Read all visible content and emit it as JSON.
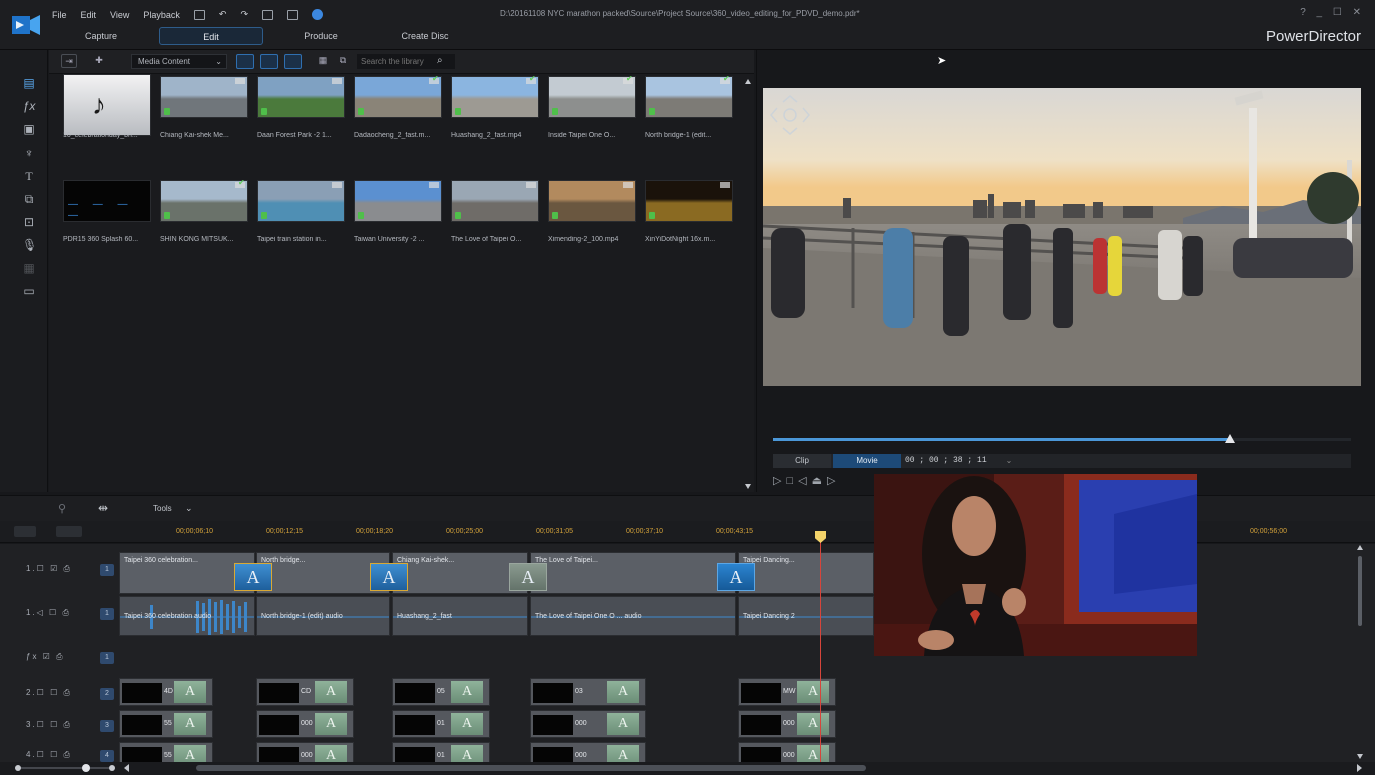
{
  "app": {
    "brand": "PowerDirector",
    "file_path": "D:\\20161108 NYC marathon packed\\Source\\Project Source\\360_video_editing_for_PDVD_demo.pdr*",
    "window_controls": "? _ ☐ ✕"
  },
  "menu": [
    "File",
    "Edit",
    "View",
    "Playback"
  ],
  "tabs": [
    {
      "label": "Capture"
    },
    {
      "label": "Edit"
    },
    {
      "label": "Produce"
    },
    {
      "label": "Create Disc"
    }
  ],
  "library": {
    "dropdown_value": "Media Content",
    "search_placeholder": "Search the library",
    "items": [
      {
        "label": "10_celebrationday_bri..."
      },
      {
        "label": "Chiang Kai-shek Me..."
      },
      {
        "label": "Daan Forest Park -2 1..."
      },
      {
        "label": "Dadaocheng_2_fast.m..."
      },
      {
        "label": "Huashang_2_fast.mp4"
      },
      {
        "label": "Inside Taipei One O..."
      },
      {
        "label": "North bridge-1 (edit..."
      },
      {
        "label": "PDR15 360 Splash 60..."
      },
      {
        "label": "SHIN KONG MITSUK..."
      },
      {
        "label": "Taipei train station in..."
      },
      {
        "label": "Taiwan University -2 ..."
      },
      {
        "label": "The Love of Taipei O..."
      },
      {
        "label": "Ximending-2_100.mp4"
      },
      {
        "label": "XinYiDotNight 16x.m..."
      }
    ]
  },
  "preview": {
    "mode_clip": "Clip",
    "mode_movie": "Movie",
    "timecode": "00 ; 00 ; 38 ; 11",
    "progress": 0.79
  },
  "timeline": {
    "tools_label": "Tools",
    "ruler": [
      "00;00;06;10",
      "00;00;12;15",
      "00;00;18;20",
      "00;00;25;00",
      "00;00;31;05",
      "00;00;37;10",
      "00;00;43;15",
      "00;00;56;00"
    ],
    "tracks": [
      {
        "label": "1.☐ ☑ ⎙",
        "type": "video"
      },
      {
        "label": "1.◁ ☐ ⎙",
        "type": "audio"
      },
      {
        "label": "ƒx ☑ ⎙",
        "type": "fx"
      },
      {
        "label": "2.☐ ☐ ⎙",
        "type": "video2"
      },
      {
        "label": "3.☐ ☐ ⎙",
        "type": "video3"
      },
      {
        "label": "4.☐ ☐ ⎙",
        "type": "video4"
      }
    ],
    "video_clips": [
      {
        "name": "Taipei 360 celebration..."
      },
      {
        "name": "North bridge..."
      },
      {
        "name": "Chiang Kai-shek..."
      },
      {
        "name": "The Love of Taipei..."
      },
      {
        "name": "Taipei Dancing..."
      }
    ],
    "audio_clips": [
      {
        "name": "Taipei 360 celebration audio"
      },
      {
        "name": "North bridge-1 (edit) audio"
      },
      {
        "name": "Huashang_2_fast"
      },
      {
        "name": "The Love of Taipei One O ... audio"
      },
      {
        "name": "Taipei Dancing 2"
      }
    ],
    "title_clips_row2": [
      "4D",
      "CD",
      "05",
      "03",
      "MW"
    ],
    "title_clips_row3": [
      "55",
      "000",
      "01",
      "000",
      "000"
    ],
    "tile_letter": "A"
  },
  "colors": {
    "accent": "#3a8ee0",
    "playhead": "#d6453b",
    "ruler_text": "#d4a23a"
  }
}
